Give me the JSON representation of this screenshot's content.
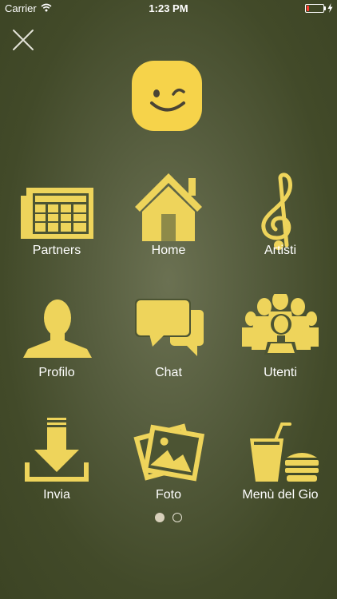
{
  "status_bar": {
    "carrier": "Carrier",
    "time": "1:23 PM"
  },
  "colors": {
    "icon": "#eed45b",
    "logo": "#f6d34a",
    "accent_red": "#ff3b30"
  },
  "menu": [
    {
      "label": "Partners",
      "icon": "newspaper-icon"
    },
    {
      "label": "Home",
      "icon": "house-icon"
    },
    {
      "label": "Artisti",
      "icon": "treble-clef-icon"
    },
    {
      "label": "Profilo",
      "icon": "person-icon"
    },
    {
      "label": "Chat",
      "icon": "chat-bubbles-icon"
    },
    {
      "label": "Utenti",
      "icon": "users-group-icon"
    },
    {
      "label": "Invia",
      "icon": "download-tray-icon"
    },
    {
      "label": "Foto",
      "icon": "photos-icon"
    },
    {
      "label": "Menù del Gio",
      "icon": "drink-burger-icon"
    }
  ],
  "pagination": {
    "current_page": 1,
    "total_pages": 2
  }
}
